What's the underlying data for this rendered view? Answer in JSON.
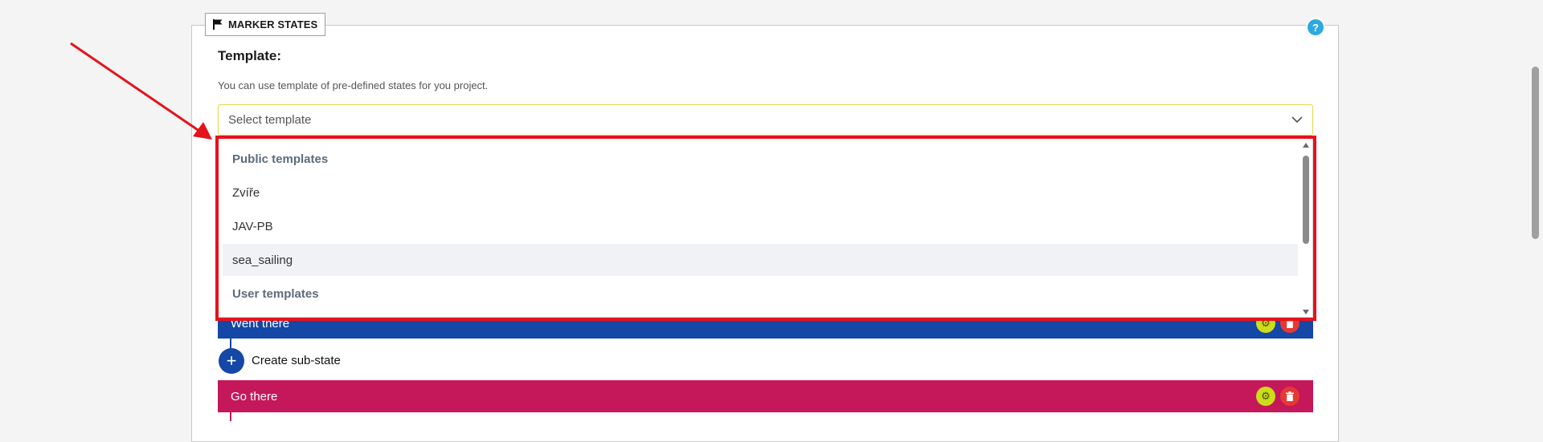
{
  "legend": {
    "title": "MARKER STATES",
    "icon": "flag-icon"
  },
  "help": {
    "label": "?"
  },
  "template": {
    "title": "Template:",
    "description": "You can use template of pre-defined states for you project.",
    "placeholder": "Select template",
    "options": [
      {
        "label": "Public templates",
        "type": "group"
      },
      {
        "label": "Zvíře",
        "type": "option"
      },
      {
        "label": "JAV-PB",
        "type": "option"
      },
      {
        "label": "sea_sailing",
        "type": "option",
        "highlighted": true
      },
      {
        "label": "User templates",
        "type": "group"
      }
    ]
  },
  "states": [
    {
      "name": "Went there",
      "color": "#1447a6"
    },
    {
      "name": "Go there",
      "color": "#c4185a"
    }
  ],
  "create_substate": {
    "label": "Create sub-state",
    "icon": "plus-icon"
  },
  "colors": {
    "annotation": "#e5131c",
    "select_focus_border": "#e2d84a",
    "help": "#2ea9df"
  }
}
